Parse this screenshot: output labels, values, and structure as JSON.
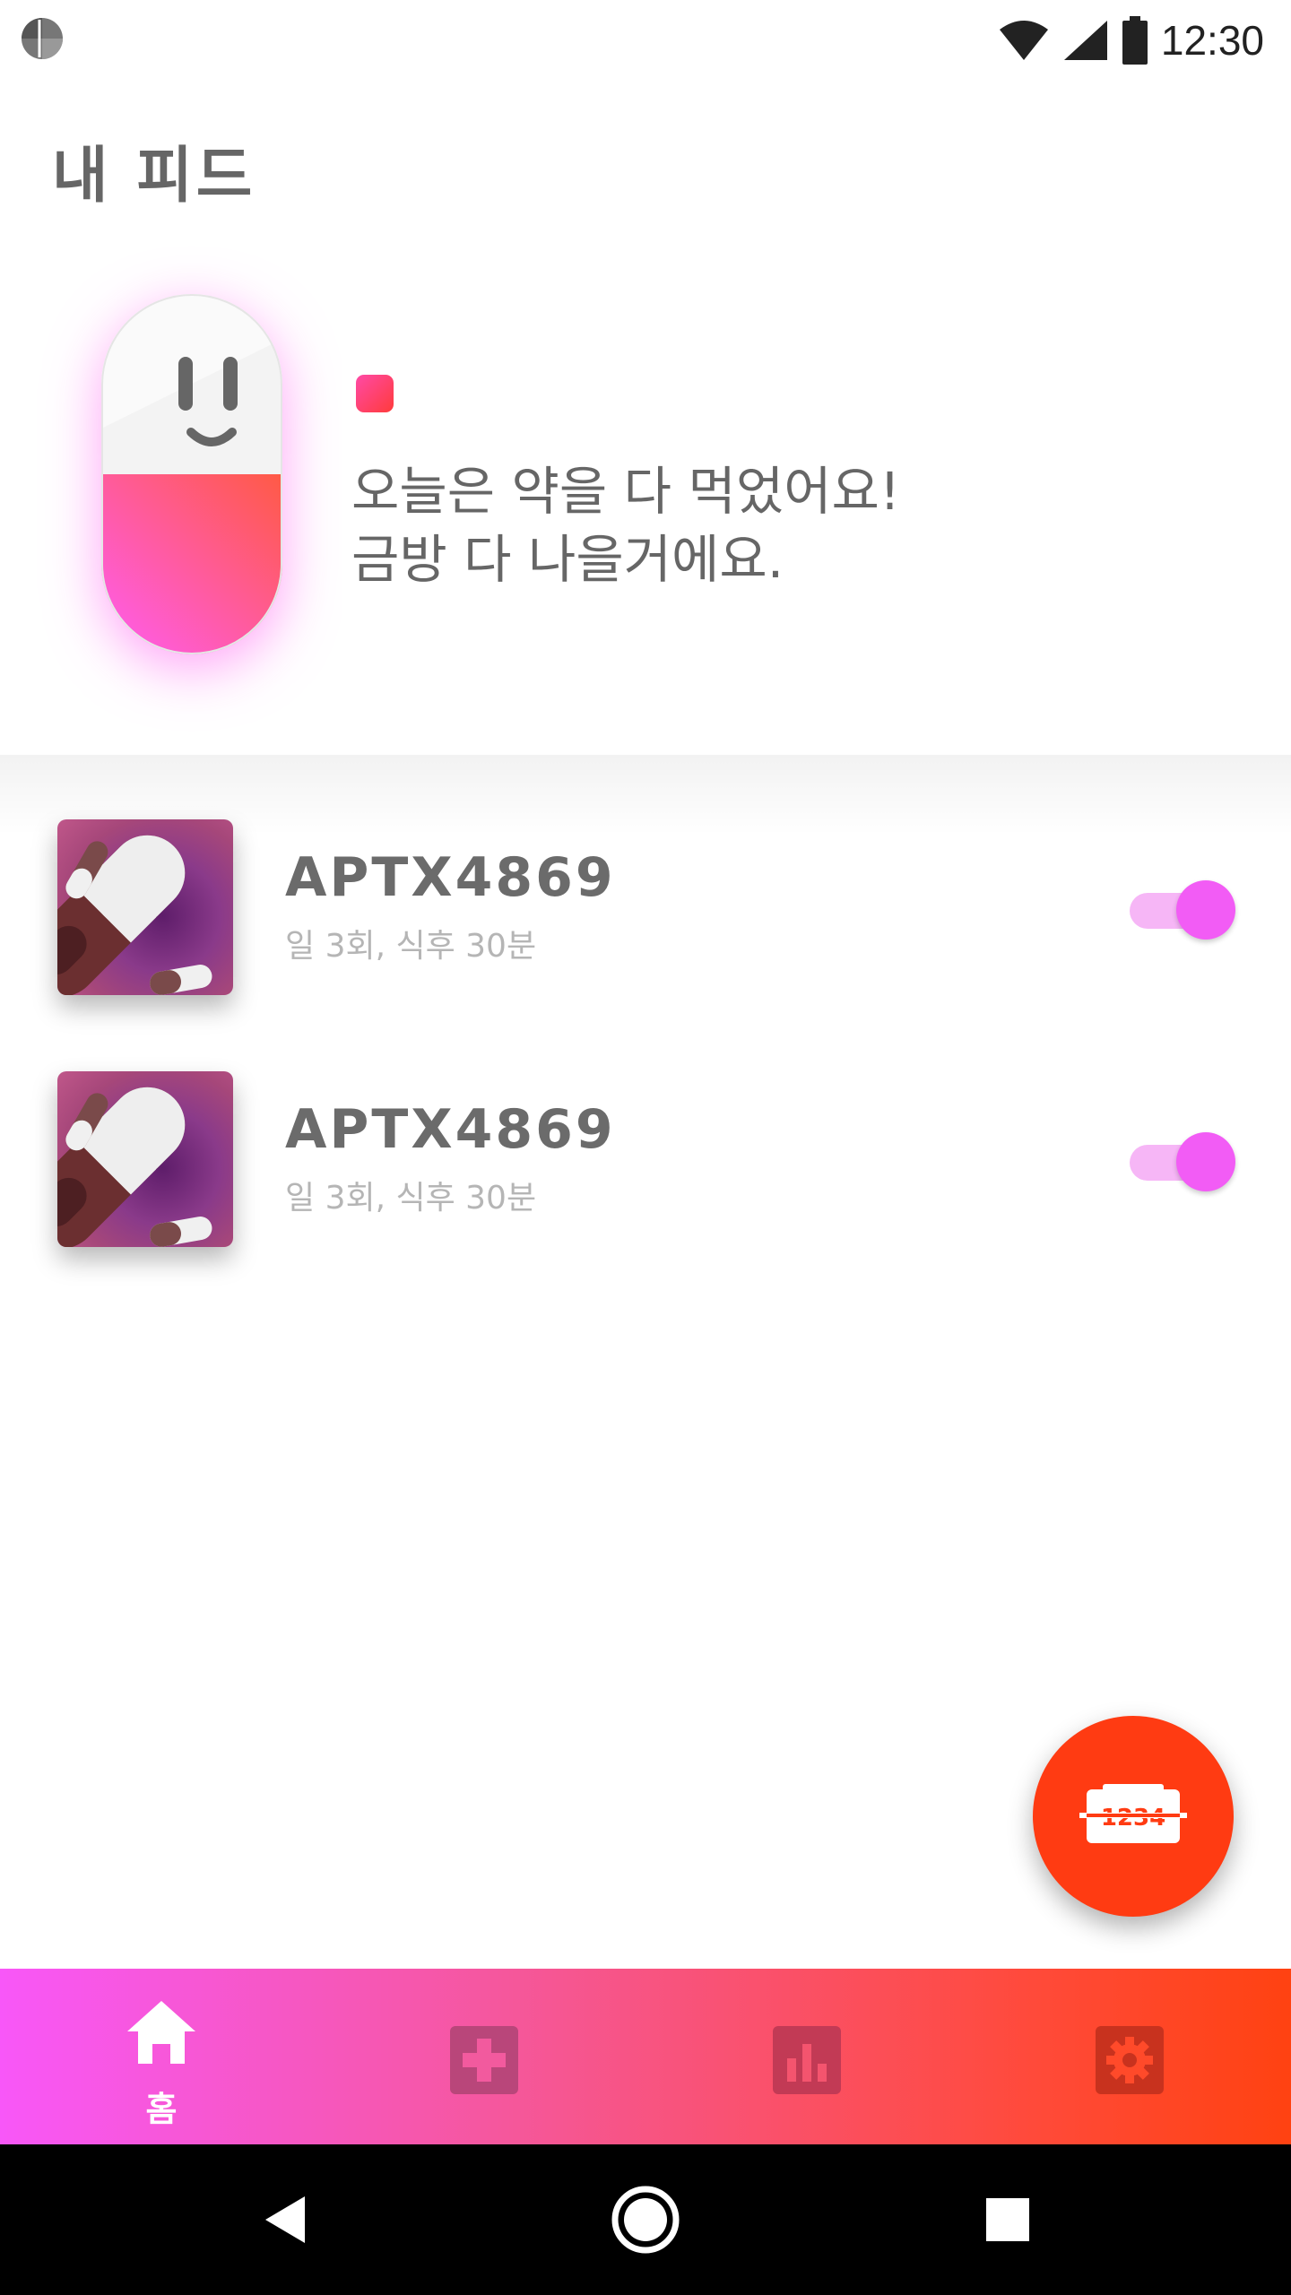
{
  "status_bar": {
    "time": "12:30"
  },
  "page": {
    "title": "내 피드"
  },
  "hero": {
    "message_line1": "오늘은 약을 다 먹었어요!",
    "message_line2": "금방 다 나을거에요."
  },
  "medications": [
    {
      "name": "APTX4869",
      "schedule": "일 3회, 식후 30분",
      "enabled": true
    },
    {
      "name": "APTX4869",
      "schedule": "일 3회, 식후 30분",
      "enabled": true
    }
  ],
  "fab": {
    "icon": "pill-barcode-icon",
    "icon_text": "1234"
  },
  "bottom_nav": {
    "items": [
      {
        "id": "home",
        "label": "홈",
        "icon": "home-icon",
        "active": true
      },
      {
        "id": "add",
        "label": "",
        "icon": "medical-cross-icon",
        "active": false
      },
      {
        "id": "stats",
        "label": "",
        "icon": "bar-chart-icon",
        "active": false
      },
      {
        "id": "settings",
        "label": "",
        "icon": "gear-icon",
        "active": false
      }
    ]
  },
  "colors": {
    "accent_pink": "#f25cf5",
    "accent_orange": "#ff3b12",
    "text_primary": "#666666",
    "text_secondary": "#b5b5b5"
  }
}
